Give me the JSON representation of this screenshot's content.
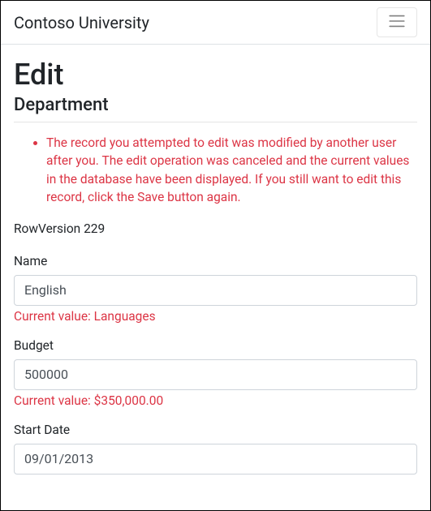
{
  "navbar": {
    "brand": "Contoso University"
  },
  "page": {
    "heading": "Edit",
    "subheading": "Department"
  },
  "validation": {
    "summary_items": [
      "The record you attempted to edit was modified by another user after you. The edit operation was canceled and the current values in the database have been displayed. If you still want to edit this record, click the Save button again."
    ]
  },
  "row_version": {
    "label": "RowVersion",
    "value": "229"
  },
  "form": {
    "name": {
      "label": "Name",
      "value": "English",
      "validation": "Current value: Languages"
    },
    "budget": {
      "label": "Budget",
      "value": "500000",
      "validation": "Current value: $350,000.00"
    },
    "start_date": {
      "label": "Start Date",
      "value": "09/01/2013"
    }
  }
}
